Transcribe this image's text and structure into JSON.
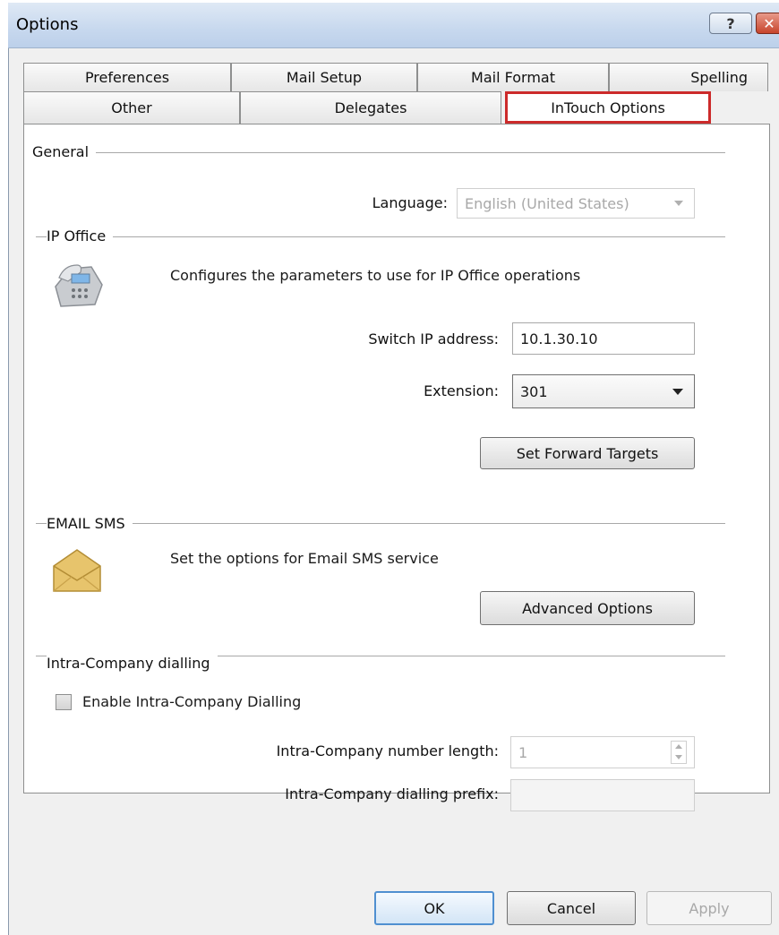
{
  "window": {
    "title": "Options",
    "help_label": "?",
    "close_label": "✕"
  },
  "tabs": {
    "row1": [
      "Preferences",
      "Mail Setup",
      "Mail Format",
      "Spelling"
    ],
    "row2": [
      "Other",
      "Delegates",
      "InTouch Options"
    ],
    "active": "InTouch Options"
  },
  "general": {
    "heading": "General",
    "language_label": "Language:",
    "language_value": "English (United States)"
  },
  "ip_office": {
    "heading": "IP Office",
    "description": "Configures the parameters to use for IP Office operations",
    "switch_ip_label": "Switch IP address:",
    "switch_ip_value": "10.1.30.10",
    "extension_label": "Extension:",
    "extension_value": "301",
    "forward_button": "Set Forward Targets",
    "icon": "phone-icon"
  },
  "email_sms": {
    "heading": "EMAIL SMS",
    "description": "Set the options for Email SMS service",
    "advanced_button": "Advanced Options",
    "icon": "envelope-icon"
  },
  "intra_company": {
    "heading": "Intra-Company dialling",
    "enable_label": "Enable Intra-Company Dialling",
    "enable_checked": false,
    "length_label": "Intra-Company number length:",
    "length_value": "1",
    "prefix_label": "Intra-Company dialling prefix:",
    "prefix_value": ""
  },
  "footer": {
    "ok": "OK",
    "cancel": "Cancel",
    "apply": "Apply"
  }
}
